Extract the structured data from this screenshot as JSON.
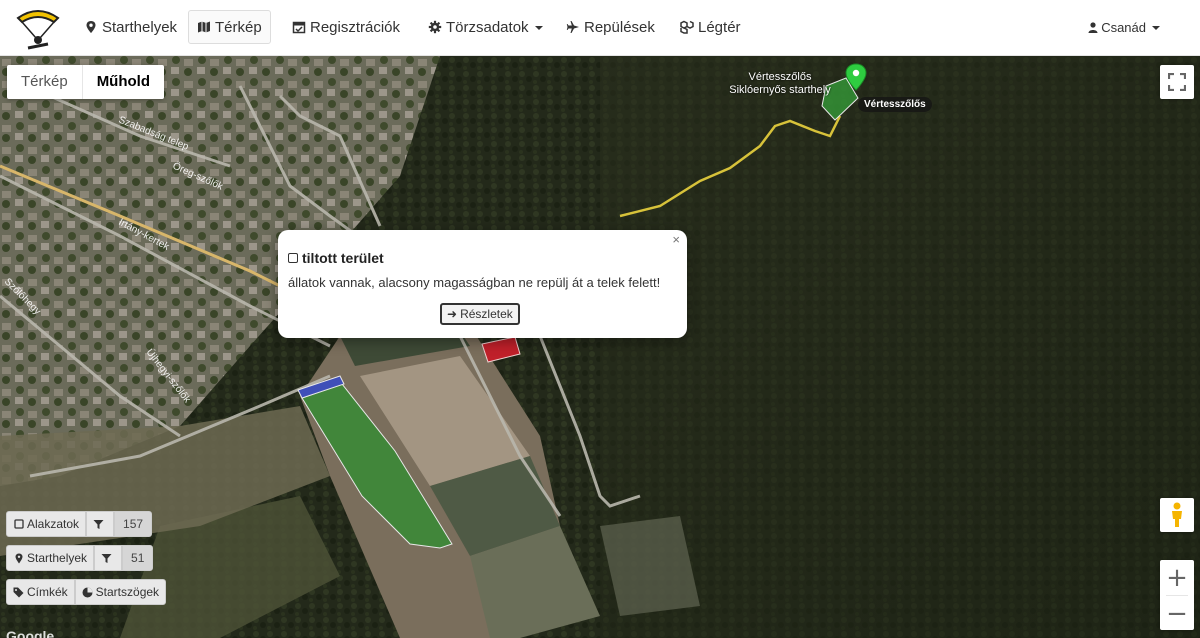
{
  "nav": {
    "items": [
      {
        "label": "Starthelyek",
        "icon": "map-marker-icon"
      },
      {
        "label": "Térkép",
        "icon": "map-icon",
        "active": true
      },
      {
        "label": "Regisztrációk",
        "icon": "calendar-check-icon"
      },
      {
        "label": "Törzsadatok",
        "icon": "gear-icon",
        "dropdown": true
      },
      {
        "label": "Repülések",
        "icon": "plane-icon"
      },
      {
        "label": "Légtér",
        "icon": "cubes-icon"
      }
    ],
    "user": "Csanád"
  },
  "map": {
    "type_buttons": [
      "Térkép",
      "Műhold"
    ],
    "selected_type": "Műhold",
    "attribution": "Google",
    "marker": {
      "name_line1": "Vértesszőlős",
      "name_line2": "Siklóernyős starthely",
      "label": "Vértesszőlős"
    },
    "places": [
      "Szabadság telep",
      "Öreg-szőlők",
      "Irtány-kertek",
      "Szőlőhegy",
      "Újhegyi-szőlők"
    ],
    "colors": {
      "forbidden": "#c0202a",
      "start_zone": "#2f8f2f",
      "route": "#d7c23a",
      "blue_zone": "#3f4fb8"
    }
  },
  "popup": {
    "title": "tiltott terület",
    "text": "állatok vannak, alacsony magasságban ne repülj át a telek felett!",
    "button": "Részletek",
    "close": "×"
  },
  "controls": {
    "shapes": {
      "label": "Alakzatok",
      "count": "157"
    },
    "starts": {
      "label": "Starthelyek",
      "count": "51"
    },
    "labels": {
      "label": "Címkék"
    },
    "angles": {
      "label": "Startszögek"
    }
  }
}
